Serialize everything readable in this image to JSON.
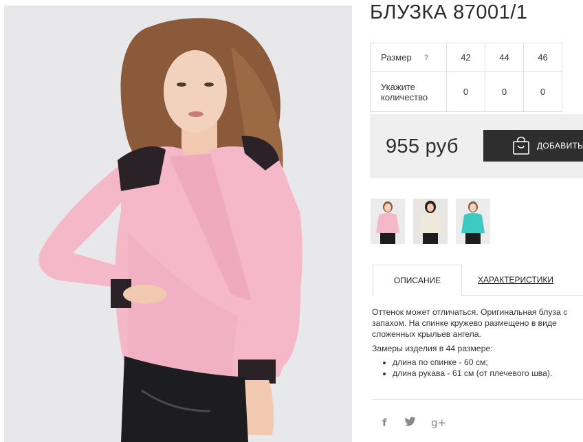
{
  "product": {
    "title": "БЛУЗКА 87001/1",
    "main_image": "pink-blouse-model-photo"
  },
  "size_table": {
    "size_label": "Размер",
    "help_icon": "question-icon",
    "help_glyph": "?",
    "qty_label_line1": "Укажите",
    "qty_label_line2": "количество",
    "sizes": [
      "42",
      "44",
      "46"
    ],
    "quantities": [
      "0",
      "0",
      "0"
    ]
  },
  "purchase": {
    "price": "955 руб",
    "add_button_label": "ДОБАВИТЬ",
    "add_button_icon": "shopping-bag-icon",
    "button_color": "#2e2e2e"
  },
  "thumbnails": [
    {
      "name": "thumb-pink",
      "color": "#f4b8c8"
    },
    {
      "name": "thumb-cream",
      "color": "#efe9dc"
    },
    {
      "name": "thumb-turquoise",
      "color": "#3fc9c3"
    }
  ],
  "tabs": {
    "description": "ОПИСАНИЕ",
    "characteristics": "ХАРАКТЕРИСТИКИ"
  },
  "description": {
    "text": "Оттенок может отличаться. Оригинальная блуза с запахом. На спинке кружево размещено в виде сложенных крыльев ангела.",
    "measure_title": "Замеры изделия в 44 размере:",
    "measures": [
      "длина по спинке - 60 см;",
      "длина рукава - 61 см (от плечевого шва)."
    ]
  },
  "social": [
    {
      "name": "facebook-icon",
      "glyph": "f"
    },
    {
      "name": "twitter-icon",
      "glyph": "🐦"
    },
    {
      "name": "google-plus-icon",
      "glyph": "g+"
    }
  ],
  "colors": {
    "accent_dark": "#2e2e2e",
    "price_box_bg": "#efefef",
    "border": "#dcdcdc",
    "blouse_pink": "#f4b8c8"
  }
}
